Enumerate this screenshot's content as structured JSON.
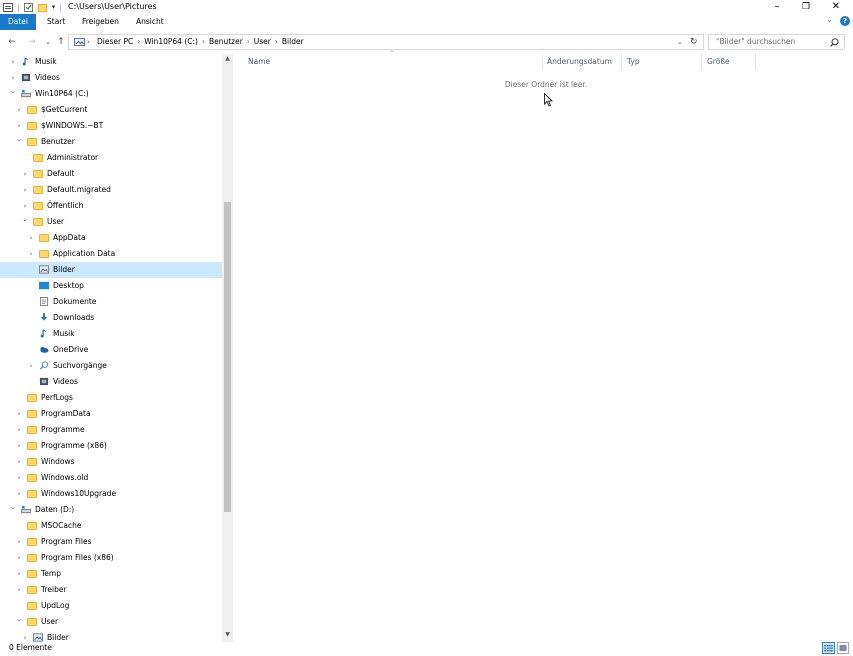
{
  "window": {
    "title": "C:\\Users\\User\\Pictures",
    "controls": {
      "minimize": "–",
      "restore": "❐",
      "close": "✕"
    }
  },
  "ribbon": {
    "tabs": [
      "Datei",
      "Start",
      "Freigeben",
      "Ansicht"
    ],
    "accent": "#1979ca"
  },
  "address": {
    "crumbs": [
      "Dieser PC",
      "Win10P64 (C:)",
      "Benutzer",
      "User",
      "Bilder"
    ],
    "search_placeholder": "\"Bilder\" durchsuchen"
  },
  "nav_tree": [
    {
      "label": "Musik",
      "icon": "music-icon",
      "level": 0,
      "exp": "collapsed"
    },
    {
      "label": "Videos",
      "icon": "videos-icon",
      "level": 0,
      "exp": "collapsed"
    },
    {
      "label": "Win10P64 (C:)",
      "icon": "drive-icon",
      "level": 0,
      "exp": "expanded"
    },
    {
      "label": "$GetCurrent",
      "icon": "folder-icon",
      "level": 1,
      "exp": "collapsed"
    },
    {
      "label": "$WINDOWS.~BT",
      "icon": "folder-icon",
      "level": 1,
      "exp": "collapsed"
    },
    {
      "label": "Benutzer",
      "icon": "folder-icon",
      "level": 1,
      "exp": "expanded"
    },
    {
      "label": "Administrator",
      "icon": "folder-icon",
      "level": 2,
      "exp": "none"
    },
    {
      "label": "Default",
      "icon": "folder-icon",
      "level": 2,
      "exp": "collapsed"
    },
    {
      "label": "Default.migrated",
      "icon": "folder-icon",
      "level": 2,
      "exp": "collapsed"
    },
    {
      "label": "Öffentlich",
      "icon": "folder-icon",
      "level": 2,
      "exp": "collapsed"
    },
    {
      "label": "User",
      "icon": "folder-icon",
      "level": 2,
      "exp": "expanded"
    },
    {
      "label": "AppData",
      "icon": "folder-icon",
      "level": 3,
      "exp": "collapsed"
    },
    {
      "label": "Application Data",
      "icon": "folder-icon",
      "level": 3,
      "exp": "collapsed"
    },
    {
      "label": "Bilder",
      "icon": "pictures-icon",
      "level": 3,
      "exp": "none",
      "selected": true
    },
    {
      "label": "Desktop",
      "icon": "desktop-icon",
      "level": 3,
      "exp": "none"
    },
    {
      "label": "Dokumente",
      "icon": "documents-icon",
      "level": 3,
      "exp": "none"
    },
    {
      "label": "Downloads",
      "icon": "downloads-icon",
      "level": 3,
      "exp": "none"
    },
    {
      "label": "Musik",
      "icon": "music-icon",
      "level": 3,
      "exp": "none"
    },
    {
      "label": "OneDrive",
      "icon": "onedrive-icon",
      "level": 3,
      "exp": "none"
    },
    {
      "label": "Suchvorgänge",
      "icon": "search-folder-icon",
      "level": 3,
      "exp": "collapsed"
    },
    {
      "label": "Videos",
      "icon": "videos-icon",
      "level": 3,
      "exp": "none"
    },
    {
      "label": "PerfLogs",
      "icon": "folder-icon",
      "level": 1,
      "exp": "none"
    },
    {
      "label": "ProgramData",
      "icon": "folder-icon",
      "level": 1,
      "exp": "collapsed"
    },
    {
      "label": "Programme",
      "icon": "folder-icon",
      "level": 1,
      "exp": "collapsed"
    },
    {
      "label": "Programme (x86)",
      "icon": "folder-icon",
      "level": 1,
      "exp": "collapsed"
    },
    {
      "label": "Windows",
      "icon": "folder-icon",
      "level": 1,
      "exp": "collapsed"
    },
    {
      "label": "Windows.old",
      "icon": "folder-icon",
      "level": 1,
      "exp": "collapsed"
    },
    {
      "label": "Windows10Upgrade",
      "icon": "folder-icon",
      "level": 1,
      "exp": "collapsed"
    },
    {
      "label": "Daten (D:)",
      "icon": "drive-icon",
      "level": 0,
      "exp": "expanded"
    },
    {
      "label": "MSOCache",
      "icon": "folder-icon",
      "level": 1,
      "exp": "none"
    },
    {
      "label": "Program Files",
      "icon": "folder-icon",
      "level": 1,
      "exp": "collapsed"
    },
    {
      "label": "Program Files (x86)",
      "icon": "folder-icon",
      "level": 1,
      "exp": "collapsed"
    },
    {
      "label": "Temp",
      "icon": "folder-icon",
      "level": 1,
      "exp": "collapsed"
    },
    {
      "label": "Treiber",
      "icon": "folder-icon",
      "level": 1,
      "exp": "collapsed"
    },
    {
      "label": "UpdLog",
      "icon": "folder-icon",
      "level": 1,
      "exp": "none"
    },
    {
      "label": "User",
      "icon": "folder-icon",
      "level": 1,
      "exp": "expanded"
    },
    {
      "label": "Bilder",
      "icon": "pictures-icon",
      "level": 2,
      "exp": "collapsed"
    }
  ],
  "columns": [
    "Name",
    "Änderungsdatum",
    "Typ",
    "Größe"
  ],
  "empty_message": "Dieser Ordner ist leer.",
  "status": {
    "count": "0 Elemente"
  }
}
